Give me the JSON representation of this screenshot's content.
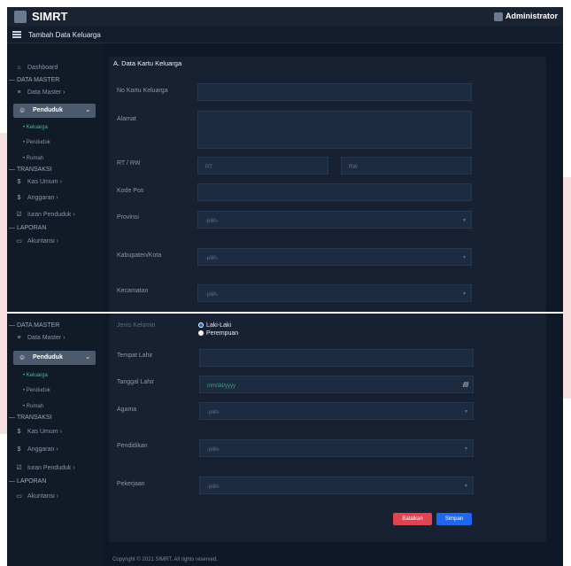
{
  "app": {
    "title": "SIMRT",
    "user": "Administrator",
    "page_title": "Tambah Data Keluarga"
  },
  "sidebar": {
    "dashboard": "Dashboard",
    "sec_master": "— DATA MASTER",
    "data_master": "Data Master",
    "penduduk": "Penduduk",
    "sub_keluarga": "Keluarga",
    "sub_penduduk": "Penduduk",
    "sub_rumah": "Rumah",
    "sec_transaksi": "— TRANSAKSI",
    "kas_umum": "Kas Umum",
    "anggaran": "Anggaran",
    "iuran": "Iuran Penduduk",
    "sec_laporan": "— LAPORAN",
    "akuntansi": "Akuntansi"
  },
  "form": {
    "section_title": "A. Data Kartu Keluarga",
    "no_kk": "No Kartu Keluarga",
    "alamat": "Alamat",
    "rt_rw": "RT / RW",
    "rt_placeholder": "RT",
    "rw_placeholder": "RW",
    "kode_pos": "Kode Pos",
    "provinsi": "Provinsi",
    "kabupaten": "Kabupaten/Kota",
    "kecamatan": "Kecamatan",
    "pilih": "-pilih-",
    "jenis_kelamin": "Jenis Kelamin",
    "laki": "Laki-Laki",
    "perempuan": "Perempuan",
    "tempat_lahir": "Tempat Lahir",
    "tanggal_lahir": "Tanggal Lahir",
    "date_placeholder": "mm/dd/yyyy",
    "agama": "Agama",
    "pendidikan": "Pendidikan",
    "pekerjaan": "Pekerjaan",
    "batalkan": "Batalkan",
    "simpan": "Simpan"
  },
  "footer": "Copyright © 2021 SIMRT. All rights reserved.",
  "colors": {
    "background": "#0f1826",
    "panel": "#172131",
    "input": "#1d2b40",
    "active_green": "#4fb89a",
    "cancel": "#e04352",
    "save": "#1e68f0"
  }
}
